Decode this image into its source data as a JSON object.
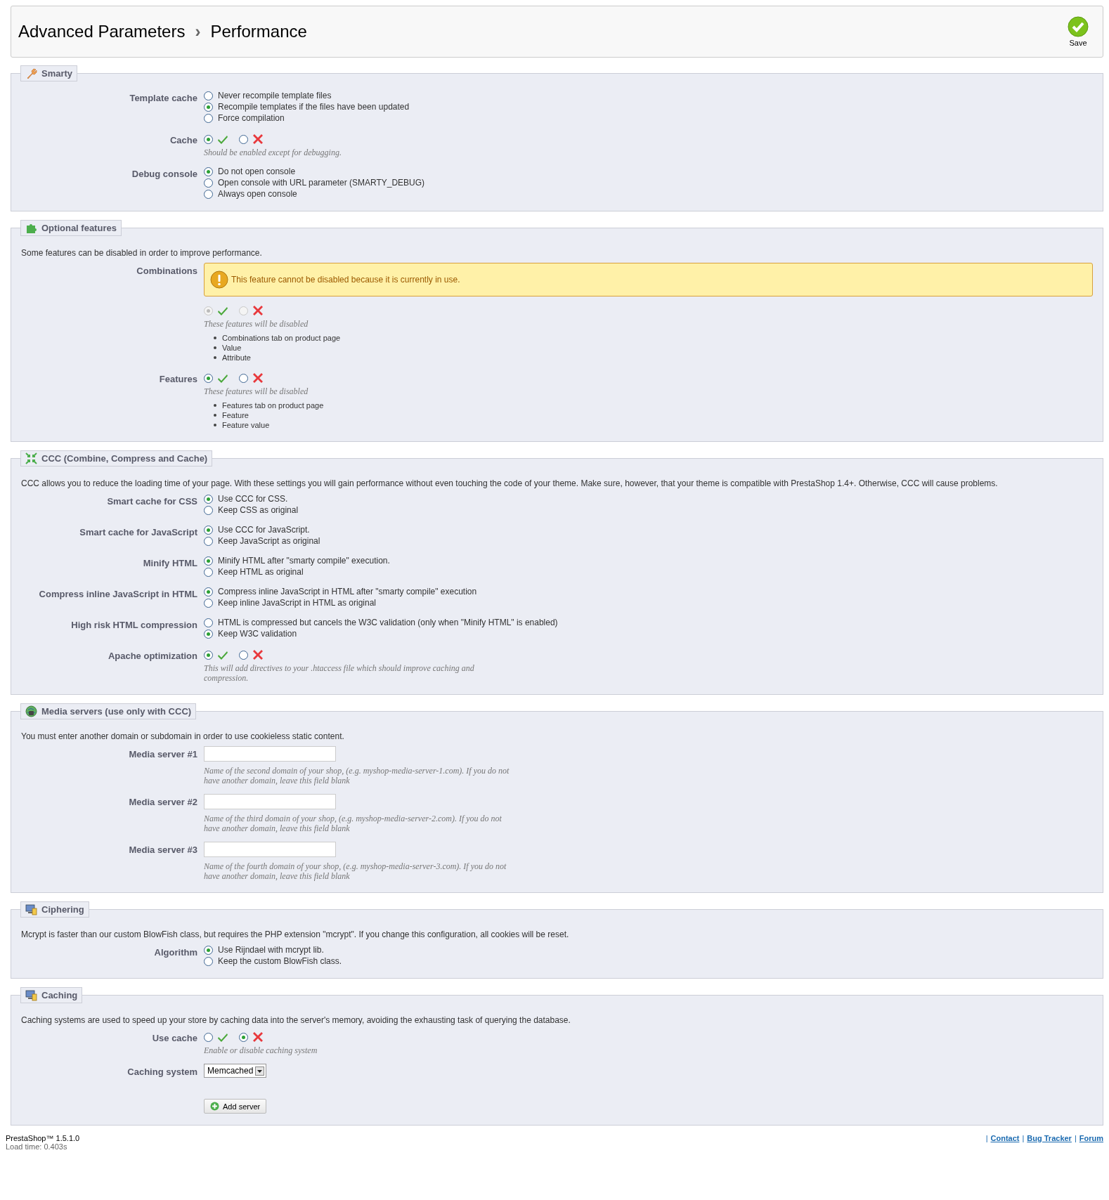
{
  "header": {
    "breadcrumb": [
      "Advanced Parameters",
      "Performance"
    ],
    "separator": "›",
    "save": "Save"
  },
  "sections": [
    {
      "title": "Smarty",
      "fields": [
        {
          "label": "Template cache",
          "kind": "radio",
          "options": [
            {
              "label": "Never recompile template files",
              "selected": false
            },
            {
              "label": "Recompile templates if the files have been updated",
              "selected": true
            },
            {
              "label": "Force compilation",
              "selected": false
            }
          ]
        },
        {
          "label": "Cache",
          "kind": "toggle",
          "on": true,
          "disabled": false,
          "hint": "Should be enabled except for debugging."
        },
        {
          "label": "Debug console",
          "kind": "radio",
          "options": [
            {
              "label": "Do not open console",
              "selected": true
            },
            {
              "label": "Open console with URL parameter (SMARTY_DEBUG)",
              "selected": false
            },
            {
              "label": "Always open console",
              "selected": false
            }
          ]
        }
      ]
    },
    {
      "title": "Optional features",
      "description": "Some features can be disabled in order to improve performance.",
      "fields": [
        {
          "label": "Combinations",
          "kind": "toggle",
          "warning": "This feature cannot be disabled because it is currently in use.",
          "on": true,
          "disabled": true,
          "hint": "These features will be disabled",
          "list": [
            "Combinations tab on product page",
            "Value",
            "Attribute"
          ]
        },
        {
          "label": "Features",
          "kind": "toggle",
          "on": true,
          "disabled": false,
          "hint": "These features will be disabled",
          "list": [
            "Features tab on product page",
            "Feature",
            "Feature value"
          ]
        }
      ]
    },
    {
      "title": "CCC (Combine, Compress and Cache)",
      "description": "CCC allows you to reduce the loading time of your page. With these settings you will gain performance without even touching the code of your theme. Make sure, however, that your theme is compatible with PrestaShop 1.4+. Otherwise, CCC will cause problems.",
      "fields": [
        {
          "label": "Smart cache for CSS",
          "kind": "radio",
          "options": [
            {
              "label": "Use CCC for CSS.",
              "selected": true
            },
            {
              "label": "Keep CSS as original",
              "selected": false
            }
          ]
        },
        {
          "label": "Smart cache for JavaScript",
          "kind": "radio",
          "options": [
            {
              "label": "Use CCC for JavaScript.",
              "selected": true
            },
            {
              "label": "Keep JavaScript as original",
              "selected": false
            }
          ]
        },
        {
          "label": "Minify HTML",
          "kind": "radio",
          "options": [
            {
              "label": "Minify HTML after \"smarty compile\" execution.",
              "selected": true
            },
            {
              "label": "Keep HTML as original",
              "selected": false
            }
          ]
        },
        {
          "label": "Compress inline JavaScript in HTML",
          "kind": "radio",
          "options": [
            {
              "label": "Compress inline JavaScript in HTML after \"smarty compile\" execution",
              "selected": true
            },
            {
              "label": "Keep inline JavaScript in HTML as original",
              "selected": false
            }
          ]
        },
        {
          "label": "High risk HTML compression",
          "kind": "radio",
          "options": [
            {
              "label": "HTML is compressed but cancels the W3C validation (only when \"Minify HTML\" is enabled)",
              "selected": false
            },
            {
              "label": "Keep W3C validation",
              "selected": true
            }
          ]
        },
        {
          "label": "Apache optimization",
          "kind": "toggle",
          "on": true,
          "disabled": false,
          "hint": "This will add directives to your .htaccess file which should improve caching and compression."
        }
      ]
    },
    {
      "title": "Media servers (use only with CCC)",
      "description": "You must enter another domain or subdomain in order to use cookieless static content.",
      "fields": [
        {
          "label": "Media server #1",
          "kind": "text",
          "hint": "Name of the second domain of your shop, (e.g. myshop-media-server-1.com). If you do not have another domain, leave this field blank"
        },
        {
          "label": "Media server #2",
          "kind": "text",
          "hint": "Name of the third domain of your shop, (e.g. myshop-media-server-2.com). If you do not have another domain, leave this field blank"
        },
        {
          "label": "Media server #3",
          "kind": "text",
          "hint": "Name of the fourth domain of your shop, (e.g. myshop-media-server-3.com). If you do not have another domain, leave this field blank"
        }
      ]
    },
    {
      "title": "Ciphering",
      "description": "Mcrypt is faster than our custom BlowFish class, but requires the PHP extension \"mcrypt\". If you change this configuration, all cookies will be reset.",
      "fields": [
        {
          "label": "Algorithm",
          "kind": "radio",
          "options": [
            {
              "label": "Use Rijndael with mcrypt lib.",
              "selected": true
            },
            {
              "label": "Keep the custom BlowFish class.",
              "selected": false
            }
          ]
        }
      ]
    },
    {
      "title": "Caching",
      "description": "Caching systems are used to speed up your store by caching data into the server's memory, avoiding the exhausting task of querying the database.",
      "fields": [
        {
          "label": "Use cache",
          "kind": "toggle",
          "on": false,
          "disabled": false,
          "hint": "Enable or disable caching system"
        },
        {
          "label": "Caching system",
          "kind": "select",
          "value": "Memcached"
        },
        {
          "kind": "button",
          "text": "Add server"
        }
      ]
    }
  ],
  "footer": {
    "version": "PrestaShop™ 1.5.1.0",
    "load_time": "Load time: 0.403s",
    "separator": "|",
    "links": [
      "Contact",
      "Bug Tracker",
      "Forum"
    ]
  }
}
